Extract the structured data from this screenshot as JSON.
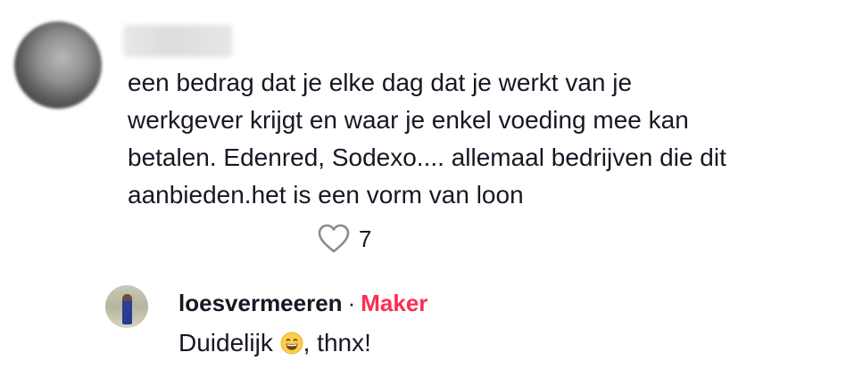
{
  "comment": {
    "text": "een bedrag dat je elke dag dat je werkt van je\nwerkgever krijgt en waar je enkel voeding mee kan\nbetalen. Edenred, Sodexo.... allemaal bedrijven die dit\naanbieden.het is een vorm van loon",
    "likes": "7",
    "like_icon": "heart-outline-icon"
  },
  "reply": {
    "username": "loesvermeeren",
    "separator": "·",
    "badge": "Maker",
    "text_before": "Duidelijk ",
    "emoji": "grinning-face-icon",
    "text_after": ", thnx!"
  },
  "colors": {
    "text": "#161823",
    "badge": "#fe2c55",
    "icon": "#8a8b91"
  }
}
